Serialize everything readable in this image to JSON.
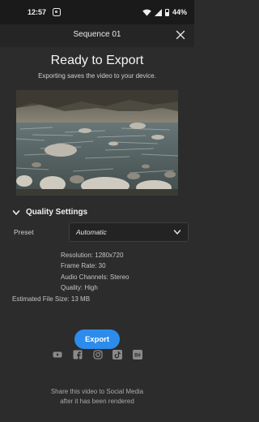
{
  "status": {
    "time": "12:57",
    "battery": "44%"
  },
  "header": {
    "title": "Sequence 01"
  },
  "export": {
    "heading": "Ready to Export",
    "subheading": "Exporting saves the video to your device.",
    "button_label": "Export"
  },
  "quality": {
    "section_label": "Quality Settings",
    "preset_label": "Preset",
    "preset_value": "Automatic",
    "resolution": "Resolution: 1280x720",
    "frame_rate": "Frame Rate: 30",
    "audio_channels": "Audio Channels: Stereo",
    "quality": "Quality: High",
    "estimated_size": "Estimated File Size: 13 MB"
  },
  "share": {
    "line1": "Share this video to Social Media",
    "line2": "after it has been rendered",
    "icons": [
      "youtube-icon",
      "facebook-icon",
      "instagram-icon",
      "tiktok-icon",
      "behance-icon"
    ]
  },
  "colors": {
    "accent": "#2d8ceb",
    "background": "#2c2c2c",
    "header": "#252525"
  }
}
